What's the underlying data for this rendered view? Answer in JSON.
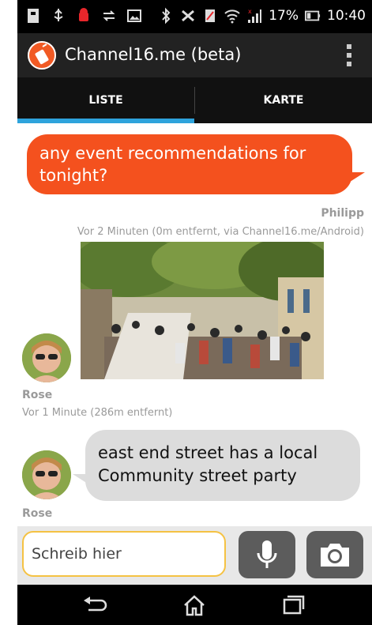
{
  "status_bar": {
    "battery": "17%",
    "time": "10:40",
    "icons": [
      "fileviewer-icon",
      "usb-icon",
      "android-debug-icon",
      "transfer-icon",
      "image-icon",
      "bluetooth-icon",
      "vibrate-icon",
      "no-sim-icon",
      "wifi-icon",
      "signal-icon",
      "battery-icon"
    ]
  },
  "action_bar": {
    "title": "Channel16.me (beta)",
    "logo_icon": "walkie-talkie-logo-icon",
    "overflow_icon": "more-vertical-icon"
  },
  "tabs": [
    {
      "label": "LISTE",
      "selected": true
    },
    {
      "label": "KARTE",
      "selected": false
    }
  ],
  "messages": [
    {
      "text": "any event recommendations for tonight?",
      "sender": "Philipp",
      "meta": "Vor 2 Minuten  (0m entfernt, via Channel16.me/Android)",
      "side": "right",
      "color": "#f4511e"
    },
    {
      "sender": "Rose",
      "meta": "Vor 1 Minute  (286m entfernt)",
      "side": "left",
      "attachment": "street-party-photo"
    },
    {
      "text": "east end street has a local Community street party",
      "sender": "Rose",
      "side": "left",
      "color": "#dcdcdc"
    }
  ],
  "input": {
    "placeholder": "Schreib hier",
    "accent": "#f5c243"
  },
  "buttons": {
    "mic_icon": "microphone-icon",
    "camera_icon": "camera-icon"
  },
  "nav_bar": {
    "icons": [
      "back-icon",
      "home-icon",
      "recent-apps-icon"
    ]
  },
  "colors": {
    "tab_indicator": "#2ea3dc",
    "action_bar": "#222222"
  }
}
